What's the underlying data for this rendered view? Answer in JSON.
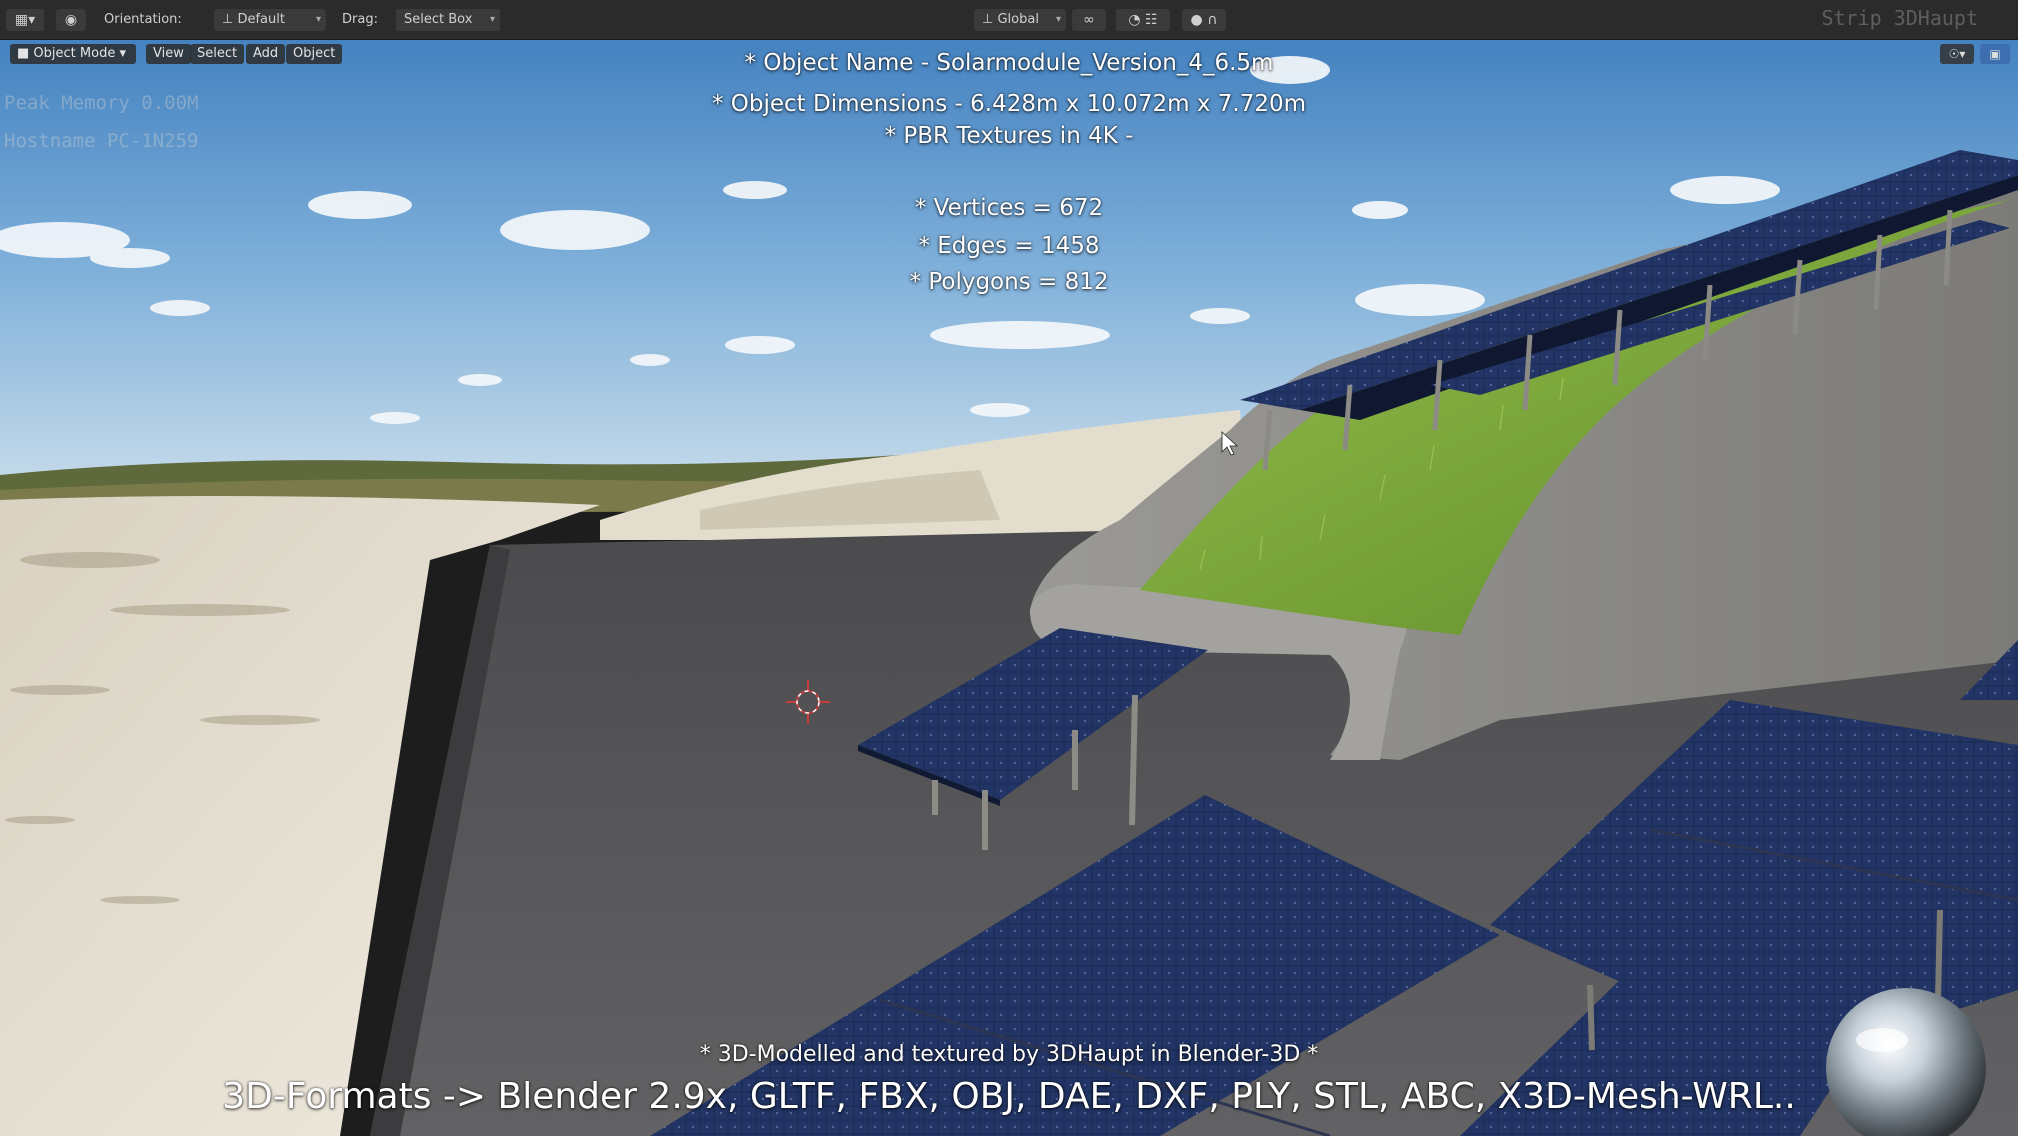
{
  "header": {
    "editor_type_icon": "editor-type-icon",
    "orientation_label": "Orientation:",
    "orientation_value": "Default",
    "drag_label": "Drag:",
    "drag_value": "Select Box",
    "transform_space": "Global",
    "strip_label": "Strip 3DHaupt"
  },
  "toolbar": {
    "mode": "Object Mode",
    "menus": [
      "View",
      "Select",
      "Add",
      "Object"
    ]
  },
  "viewport_info": {
    "line1": "Peak Memory 0.00M",
    "line2": "Hostname PC-1N259"
  },
  "overlay": {
    "name_line": "* Object Name - Solarmodule_Version_4_6.5m",
    "dims_line": "* Object Dimensions -  6.428m x 10.072m x 7.720m",
    "pbr_line": "* PBR Textures in 4K -",
    "vertices_line": "* Vertices = 672",
    "edges_line": "* Edges = 1458",
    "polygons_line": "* Polygons = 812",
    "credit_line": "* 3D-Modelled and textured by 3DHaupt in Blender-3D *",
    "formats_line": "3D-Formats -> Blender 2.9x, GLTF, FBX, OBJ, DAE, DXF, PLY, STL, ABC, X3D-Mesh-WRL.."
  },
  "colors": {
    "sky_top": "#3f7fc0",
    "sky_bottom": "#bcd6ea",
    "grass": "#7ea73c",
    "concrete": "#8d8c88",
    "asphalt": "#58585a",
    "panel": "#1c2c55",
    "ui_bg": "#2b2b2b"
  }
}
